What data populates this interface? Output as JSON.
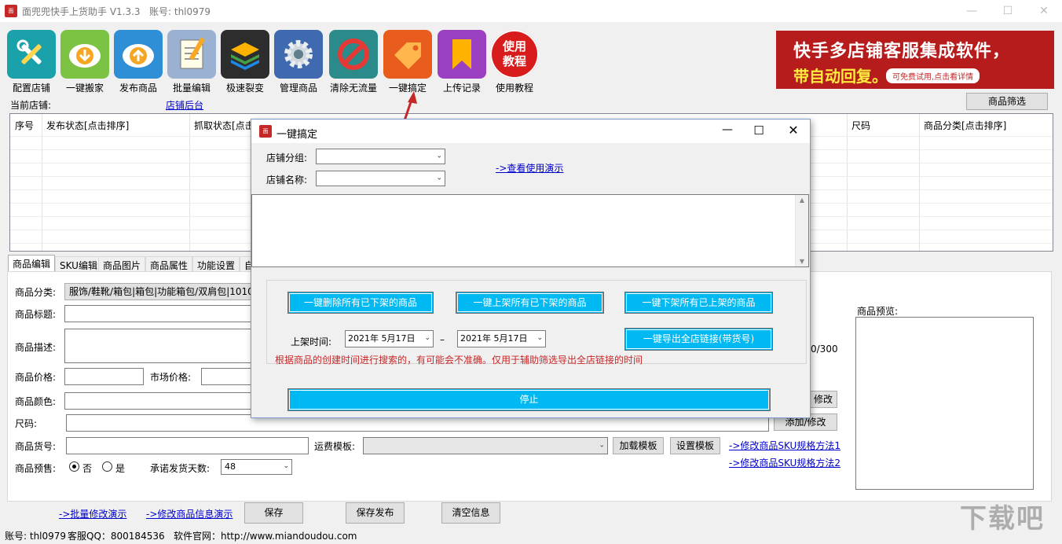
{
  "window": {
    "title": "面兜兜快手上货助手 V1.3.3",
    "account_label": "账号: thl0979"
  },
  "toolbar": [
    {
      "label": "配置店铺",
      "icon": "tools-icon",
      "color": "#1aa1a9"
    },
    {
      "label": "一键搬家",
      "icon": "download-icon",
      "color": "#7cc243"
    },
    {
      "label": "发布商品",
      "icon": "upload-icon",
      "color": "#2f8fd6"
    },
    {
      "label": "批量编辑",
      "icon": "notepad-icon",
      "color": "#9ab1d1"
    },
    {
      "label": "极速裂变",
      "icon": "layers-icon",
      "color": "#2d2d2d"
    },
    {
      "label": "管理商品",
      "icon": "gear-icon",
      "color": "#3f6ab0"
    },
    {
      "label": "清除无流量",
      "icon": "forbidden-icon",
      "color": "#2b8b8b"
    },
    {
      "label": "一键搞定",
      "icon": "tag-icon",
      "color": "#e85d1d"
    },
    {
      "label": "上传记录",
      "icon": "bookmark-icon",
      "color": "#9a3fbf"
    },
    {
      "label": "使用教程",
      "icon": "tutorial-badge",
      "text": "使用\n教程",
      "color": "#d81b1b"
    }
  ],
  "banner": {
    "line1": "快手多店铺客服集成软件，",
    "line2": "带自动回复。",
    "pill": "可免费试用,点击看详情"
  },
  "store_bar": {
    "label": "当前店铺:",
    "backend_link": "店铺后台",
    "filter_button": "商品筛选"
  },
  "grid": {
    "headers": [
      "序号",
      "发布状态[点击排序]",
      "抓取状态[点击",
      "尺码",
      "商品分类[点击排序]"
    ]
  },
  "tabs": [
    "商品编辑",
    "SKU编辑",
    "商品图片",
    "商品属性",
    "功能设置",
    "自"
  ],
  "form": {
    "category_label": "商品分类:",
    "category_value": "服饰/鞋靴/箱包|箱包|功能箱包/双肩包|1010",
    "title_label": "商品标题:",
    "desc_label": "商品描述:",
    "desc_counter": "0/300",
    "price_label": "商品价格:",
    "market_price_label": "市场价格:",
    "color_label": "商品颜色:",
    "size_label": "尺码:",
    "modify_btn_1": "修改",
    "modify_btn_2": "添加/修改",
    "sku_no_label": "商品货号:",
    "freight_label": "运费模板:",
    "load_template": "加载模板",
    "set_template": "设置模板",
    "sku_link_1": "->修改商品SKU规格方法1",
    "sku_link_2": "->修改商品SKU规格方法2",
    "presale_label": "商品预售:",
    "presale_no": "否",
    "presale_yes": "是",
    "ship_days_label": "承诺发货天数:",
    "ship_days_value": "48",
    "preview_label": "商品预览:"
  },
  "bottom": {
    "batch_demo": "->批量修改演示",
    "info_demo": "->修改商品信息演示",
    "save": "保存",
    "save_publish": "保存发布",
    "clear": "清空信息"
  },
  "statusbar": {
    "account": "账号: thl0979",
    "qq": "客服QQ：800184536",
    "site": "软件官网：http://www.miandoudou.com"
  },
  "dialog": {
    "title": "一键搞定",
    "group_label": "店铺分组:",
    "name_label": "店铺名称:",
    "demo_link": "->查看使用演示",
    "btn_delete": "一键删除所有已下架的商品",
    "btn_list": "一键上架所有已下架的商品",
    "btn_delist": "一键下架所有已上架的商品",
    "time_label": "上架时间:",
    "date_from": "2021年 5月17日",
    "date_sep": "–",
    "date_to": "2021年 5月17日",
    "btn_export": "一键导出全店链接(带货号)",
    "warning": "根据商品的创建时间进行搜索的，有可能会不准确。仅用于辅助筛选导出全店链接的时间",
    "btn_stop": "停止"
  },
  "watermark": "下载吧"
}
